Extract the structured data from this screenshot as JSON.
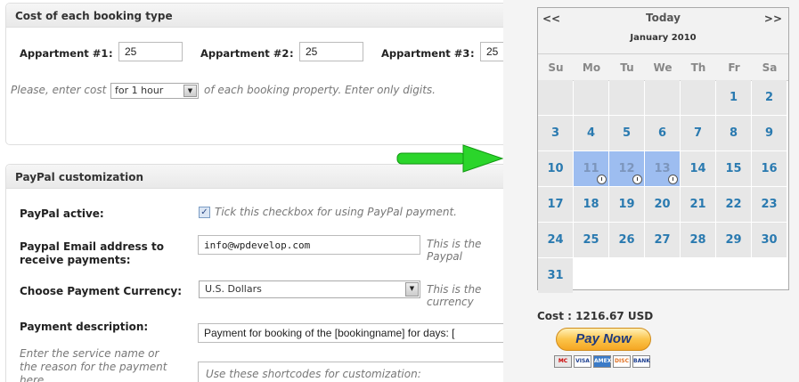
{
  "booking_cost": {
    "title": "Cost of each booking type",
    "fields": [
      {
        "label": "Appartment #1",
        "colon": ":",
        "value": "25"
      },
      {
        "label": "Appartment #2",
        "colon": ":",
        "value": "25"
      },
      {
        "label": "Appartment #3",
        "colon": ":",
        "value": "25"
      }
    ],
    "hint_before": "Please, enter cost",
    "period_option": "for 1 hour",
    "hint_after": "of each booking property. Enter only digits."
  },
  "paypal": {
    "title": "PayPal customization",
    "active_label": "PayPal active:",
    "active_hint": "Tick this checkbox for using PayPal payment.",
    "email_label_1": "Paypal Email address to",
    "email_label_2": "receive payments:",
    "email_value": "info@wpdevelop.com",
    "email_hint": "This is the Paypal",
    "currency_label": "Choose Payment Currency:",
    "currency_value": "U.S. Dollars",
    "currency_hint": "This is the currency",
    "description_label": "Payment description:",
    "description_value": "Payment for booking of the [bookingname] for days: [",
    "description_help_1": "Enter the service name or",
    "description_help_2": "the reason for the payment",
    "description_help_3": "here.",
    "textarea_text": "Use these shortcodes for customization:"
  },
  "calendar": {
    "prev": "<<",
    "next": ">>",
    "today": "Today",
    "month": "January 2010",
    "weekdays": [
      "Su",
      "Mo",
      "Tu",
      "We",
      "Th",
      "Fr",
      "Sa"
    ],
    "days": [
      "1",
      "2",
      "3",
      "4",
      "5",
      "6",
      "7",
      "8",
      "9",
      "10",
      "11",
      "12",
      "13",
      "14",
      "15",
      "16",
      "17",
      "18",
      "19",
      "20",
      "21",
      "22",
      "23",
      "24",
      "25",
      "26",
      "27",
      "28",
      "29",
      "30",
      "31"
    ],
    "booked_days": [
      11,
      12,
      13
    ]
  },
  "checkout": {
    "cost_text": "Cost : 1216.67 USD",
    "pay_button": "Pay Now",
    "cards": [
      "MC",
      "VISA",
      "AMEX",
      "DISC",
      "BANK"
    ]
  },
  "colors": {
    "arrow": "#22cc22",
    "booked": "#9dbdf0",
    "day_link": "#2a7ab0"
  }
}
